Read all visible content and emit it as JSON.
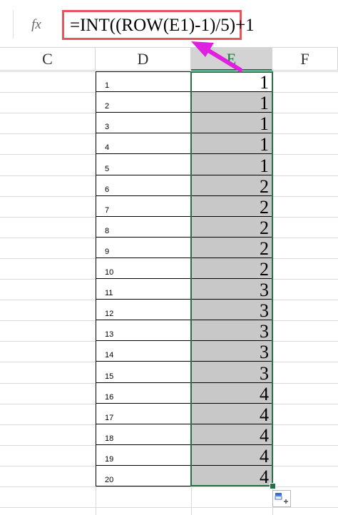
{
  "formula_bar": {
    "fx_label": "fx",
    "formula": "=INT((ROW(E1)-1)/5)+1"
  },
  "columns": [
    "C",
    "D",
    "E",
    "F"
  ],
  "rows": [
    {
      "d": "1",
      "e": "1"
    },
    {
      "d": "2",
      "e": "1"
    },
    {
      "d": "3",
      "e": "1"
    },
    {
      "d": "4",
      "e": "1"
    },
    {
      "d": "5",
      "e": "1"
    },
    {
      "d": "6",
      "e": "2"
    },
    {
      "d": "7",
      "e": "2"
    },
    {
      "d": "8",
      "e": "2"
    },
    {
      "d": "9",
      "e": "2"
    },
    {
      "d": "10",
      "e": "2"
    },
    {
      "d": "11",
      "e": "3"
    },
    {
      "d": "12",
      "e": "3"
    },
    {
      "d": "13",
      "e": "3"
    },
    {
      "d": "14",
      "e": "3"
    },
    {
      "d": "15",
      "e": "3"
    },
    {
      "d": "16",
      "e": "4"
    },
    {
      "d": "17",
      "e": "4"
    },
    {
      "d": "18",
      "e": "4"
    },
    {
      "d": "19",
      "e": "4"
    },
    {
      "d": "20",
      "e": "4"
    }
  ],
  "colors": {
    "highlight_box": "#e8545e",
    "arrow": "#e020e0",
    "selection": "#217346",
    "selected_fill": "#c8c8c8"
  },
  "icons": {
    "fx": "fx-icon",
    "arrow": "arrow-annotation-icon",
    "quick_analysis": "quick-analysis-icon"
  }
}
